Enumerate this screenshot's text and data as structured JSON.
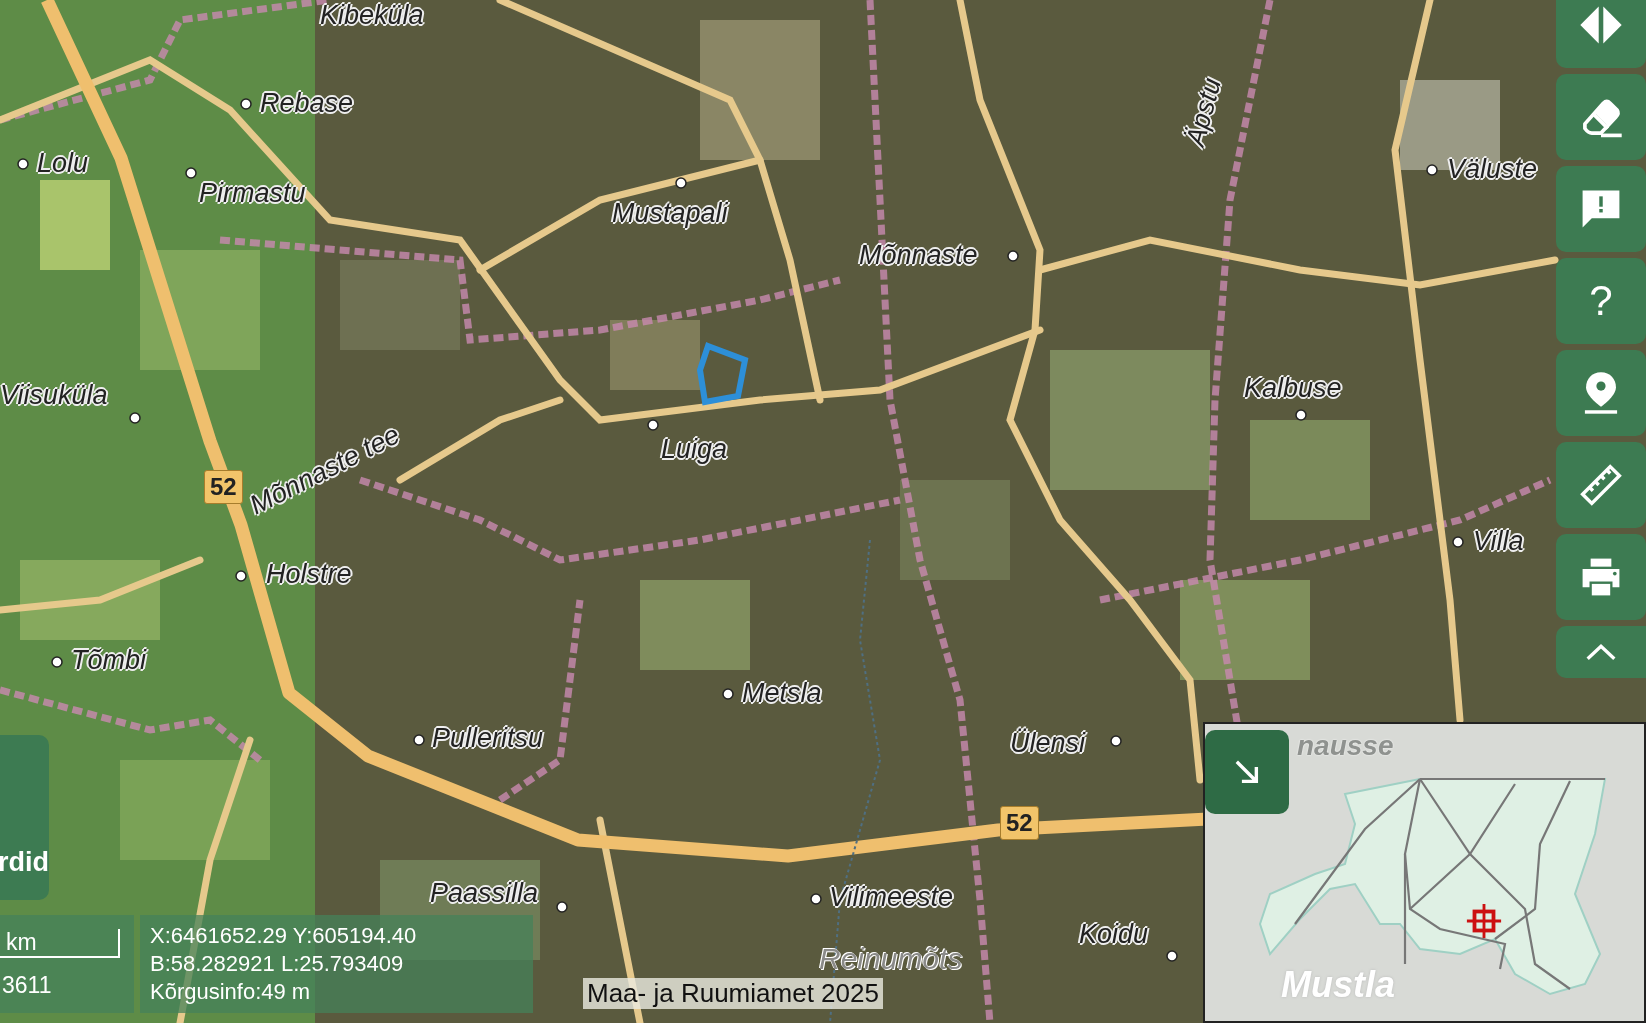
{
  "map": {
    "place_labels": [
      {
        "name": "Kibeküla"
      },
      {
        "name": "Rebase"
      },
      {
        "name": "Lolu"
      },
      {
        "name": "Pirmastu"
      },
      {
        "name": "Mustapali"
      },
      {
        "name": "Mõnnaste"
      },
      {
        "name": "Väluste"
      },
      {
        "name": "Äpstu"
      },
      {
        "name": "Viisuküla"
      },
      {
        "name": "Luiga"
      },
      {
        "name": "Kalbuse"
      },
      {
        "name": "Mõnnaste tee"
      },
      {
        "name": "Holstre"
      },
      {
        "name": "Villa"
      },
      {
        "name": "Tõmbi"
      },
      {
        "name": "Metsla"
      },
      {
        "name": "Pulleritsu"
      },
      {
        "name": "Ülensi"
      },
      {
        "name": "Vilimeeste"
      },
      {
        "name": "Paassilla"
      },
      {
        "name": "Koidu"
      },
      {
        "name": "Reinumõts"
      }
    ],
    "road_numbers": [
      "52",
      "52"
    ]
  },
  "toolbar": [
    {
      "kind": "split"
    },
    {
      "kind": "eraser"
    },
    {
      "kind": "feedback"
    },
    {
      "kind": "help",
      "label": "?"
    },
    {
      "kind": "location"
    },
    {
      "kind": "ruler"
    },
    {
      "kind": "print"
    },
    {
      "kind": "collapse"
    }
  ],
  "side_button": {
    "label": "rdid"
  },
  "scale": {
    "unit": "km",
    "ratio": "3611"
  },
  "coordinates": [
    "X:6461652.29 Y:605194.40",
    "B:58.282921 L:25.793409",
    "Kõrgusinfo:49 m"
  ],
  "attribution": "Maa- ja Ruumiamet 2025",
  "overview_map": {
    "labels": [
      "nausse",
      "Mustla"
    ]
  }
}
